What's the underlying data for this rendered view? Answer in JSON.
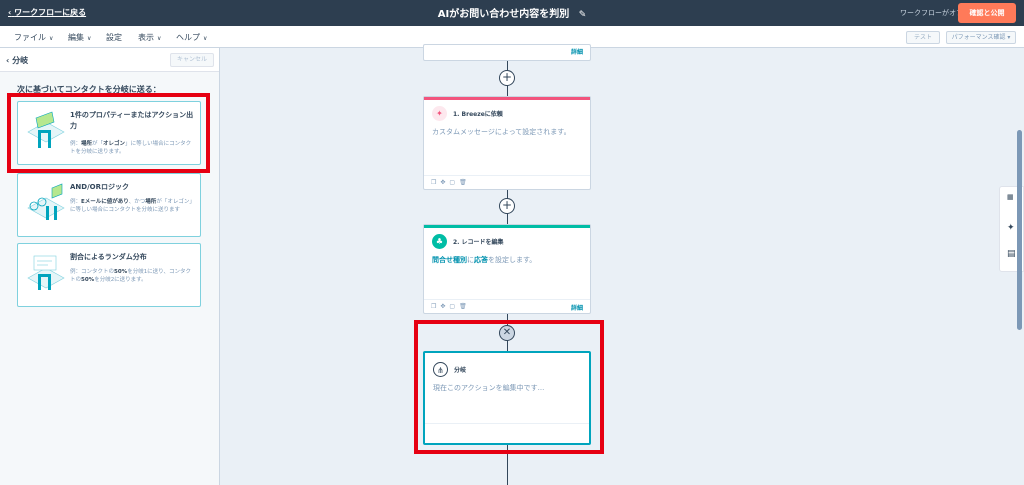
{
  "topbar": {
    "back": "ワークフローに戻る",
    "title": "AIがお問い合わせ内容を判別",
    "status": "ワークフローがオフ",
    "publish": "確認と公開"
  },
  "menu": {
    "items": [
      "ファイル",
      "編集",
      "設定",
      "表示",
      "ヘルプ"
    ],
    "test": "テスト",
    "performance": "パフォーマンス確認"
  },
  "leftpanel": {
    "back": "分岐",
    "cancel": "キャンセル",
    "label": "次に基づいてコンタクトを分岐に送る：",
    "options": [
      {
        "title": "1件のプロパティーまたはアクション出力",
        "desc_pre": "例：",
        "desc_b1": "場所",
        "desc_mid": "が「",
        "desc_b2": "オレゴン",
        "desc_post": "」に等しい場合にコンタクトを分岐に送ります。"
      },
      {
        "title": "AND/ORロジック",
        "desc_pre": "例：",
        "desc_b1": "Eメールに値があり",
        "desc_mid": "、かつ",
        "desc_b2": "場所",
        "desc_post": "が「オレゴン」に等しい場合にコンタクトを分岐に送ります"
      },
      {
        "title": "割合によるランダム分布",
        "desc_pre": "例：コンタクトの",
        "desc_b1": "50%",
        "desc_mid": "を分岐1に送り、コンタクトの",
        "desc_b2": "50%",
        "desc_post": "を分岐2に送ります。"
      }
    ]
  },
  "canvas": {
    "top_card": {
      "detail": "詳細"
    },
    "card1": {
      "title": "1. Breezeに依頼",
      "body": "カスタムメッセージによって設定されます。"
    },
    "card2": {
      "title": "2. レコードを編集",
      "body_hl1": "問合せ種別",
      "body_mid": "に",
      "body_hl2": "応答",
      "body_post": "を設定します。",
      "detail": "詳細"
    },
    "card3": {
      "title": "分岐",
      "body": "現在このアクションを編集中です..."
    }
  },
  "icons": {
    "plus": "+",
    "close": "✕",
    "back": "‹",
    "chevron": "∨",
    "pencil": "✎",
    "breeze": "✦",
    "record": "♣",
    "branch": "⋔",
    "foot": "❐✥▢🗑"
  },
  "colors": {
    "topbar": "#2d3e50",
    "publish": "#ff7a59",
    "breeze": "#f2547d",
    "record": "#00bda5",
    "highlight": "#e60012",
    "active": "#00a4bd"
  }
}
